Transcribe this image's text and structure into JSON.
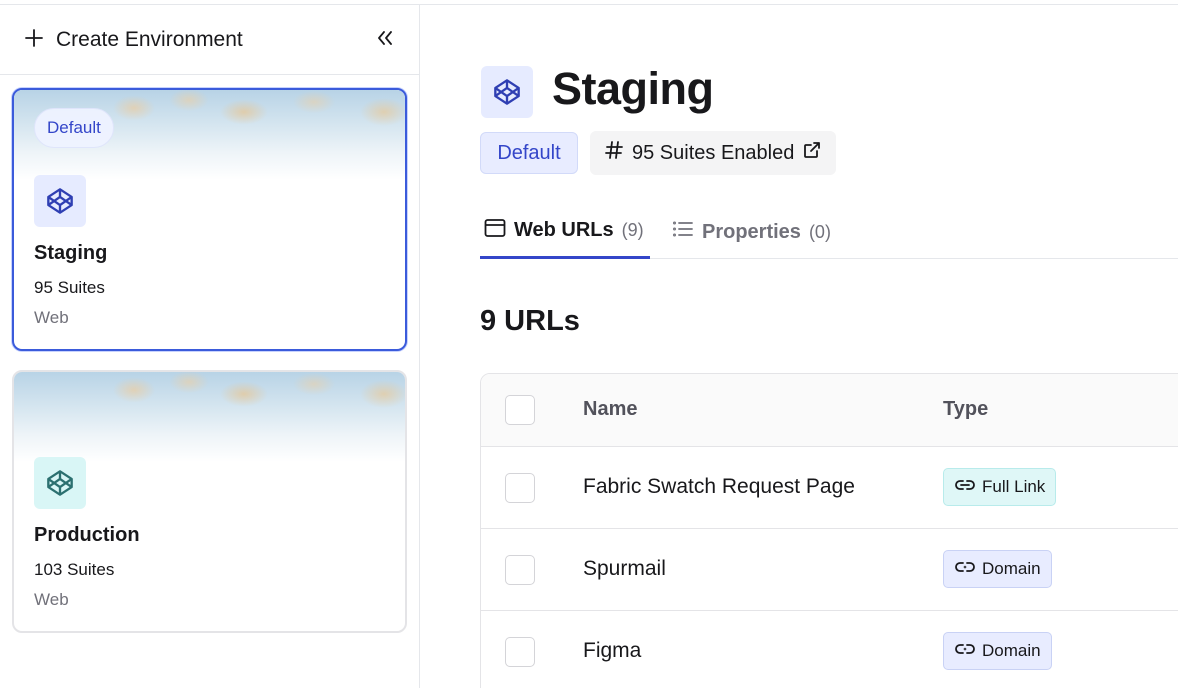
{
  "sidebar": {
    "create_label": "Create Environment",
    "collapse_icon": "chevrons-left-icon",
    "environments": [
      {
        "badge": "Default",
        "name": "Staging",
        "suites": "95 Suites",
        "type": "Web",
        "icon": "codepen-icon",
        "icon_color": "#2f3fb3"
      },
      {
        "name": "Production",
        "suites": "103 Suites",
        "type": "Web",
        "icon": "codepen-icon",
        "icon_color": "#2c7070"
      }
    ]
  },
  "main": {
    "title": "Staging",
    "default_badge": "Default",
    "suites_badge": "95 Suites Enabled",
    "tabs": [
      {
        "label": "Web URLs",
        "count": "(9)",
        "icon": "browser-window-icon"
      },
      {
        "label": "Properties",
        "count": "(0)",
        "icon": "list-icon"
      }
    ],
    "section_title": "9 URLs",
    "table": {
      "headers": {
        "name": "Name",
        "type": "Type"
      },
      "rows": [
        {
          "name": "Fabric Swatch Request Page",
          "type": "Full Link"
        },
        {
          "name": "Spurmail",
          "type": "Domain"
        },
        {
          "name": "Figma",
          "type": "Domain"
        }
      ]
    }
  },
  "colors": {
    "accent": "#3446c9",
    "selected_border": "#3b5bdb",
    "full_link_bg": "#dff7f7",
    "domain_bg": "#e8ecff"
  }
}
